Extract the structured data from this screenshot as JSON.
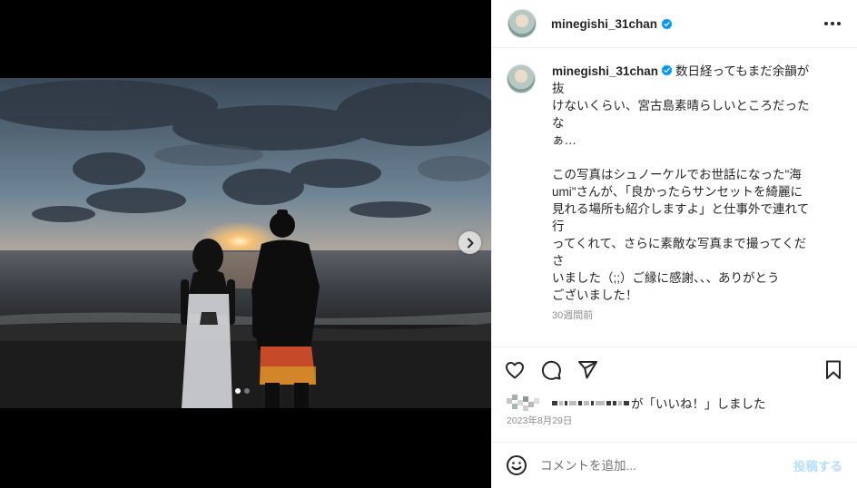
{
  "post": {
    "username": "minegishi_31chan",
    "verified": true,
    "caption_line1": "数日経ってもまだ余韻が抜",
    "caption_text": "けないくらい、宮古島素晴らしいところだったな\nぁ…\n\nこの写真はシュノーケルでお世話になった\"海\numi\"さんが、「良かったらサンセットを綺麗に\n見れる場所も紹介しますよ」と仕事外で連れて行\nってくれて、さらに素敵な写真まで撮ってくださ\nいました（;;）ご縁に感謝、、、ありがとう\nございました！",
    "time_ago": "30週間前",
    "likes_text": "が「いいね！」しました",
    "date": "2023年8月29日",
    "comment_placeholder": "コメントを追加...",
    "post_button": "投稿する"
  },
  "carousel": {
    "slide_count": 2,
    "active_slide": 1
  },
  "icons": {
    "more": "more-horizontal-icon",
    "like": "heart-icon",
    "comment": "comment-icon",
    "share": "send-icon",
    "save": "bookmark-icon",
    "emoji": "emoji-icon",
    "next": "chevron-right-icon",
    "verified": "verified-badge-icon"
  },
  "colors": {
    "verified": "#0095f6",
    "post_button_disabled": "#b2dffc",
    "muted_text": "#8e8e8e"
  }
}
